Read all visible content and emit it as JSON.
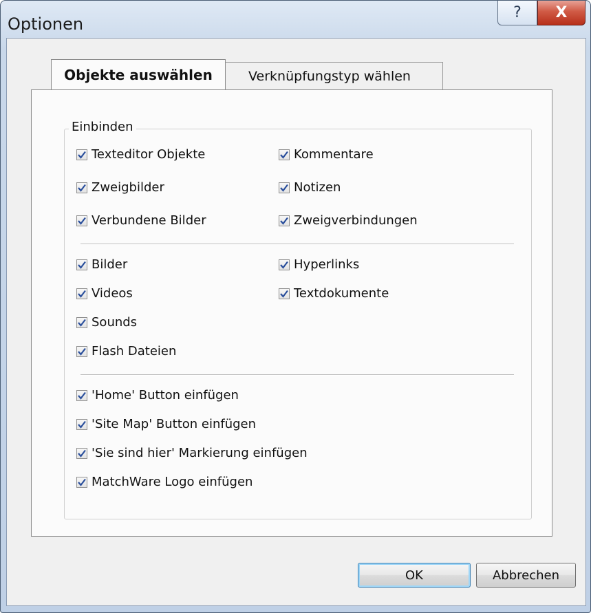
{
  "window": {
    "title": "Optionen",
    "help_label": "?",
    "close_label": "X"
  },
  "tabs": [
    {
      "label": "Objekte auswählen",
      "active": true
    },
    {
      "label": "Verknüpfungstyp wählen",
      "active": false
    }
  ],
  "group": {
    "title": "Einbinden",
    "section1": [
      {
        "label": "Texteditor Objekte",
        "checked": true
      },
      {
        "label": "Kommentare",
        "checked": true
      },
      {
        "label": "Zweigbilder",
        "checked": true
      },
      {
        "label": "Notizen",
        "checked": true
      },
      {
        "label": "Verbundene Bilder",
        "checked": true
      },
      {
        "label": "Zweigverbindungen",
        "checked": true
      }
    ],
    "section2": [
      {
        "label": "Bilder",
        "checked": true
      },
      {
        "label": "Hyperlinks",
        "checked": true
      },
      {
        "label": "Videos",
        "checked": true
      },
      {
        "label": "Textdokumente",
        "checked": true
      },
      {
        "label": "Sounds",
        "checked": true
      },
      {
        "label": "Flash Dateien",
        "checked": true
      }
    ],
    "section3": [
      {
        "label": "'Home' Button einfügen",
        "checked": true
      },
      {
        "label": "'Site Map' Button einfügen",
        "checked": true
      },
      {
        "label": "'Sie sind hier' Markierung einfügen",
        "checked": true
      },
      {
        "label": "MatchWare Logo einfügen",
        "checked": true
      }
    ]
  },
  "buttons": {
    "ok": "OK",
    "cancel": "Abbrechen"
  }
}
